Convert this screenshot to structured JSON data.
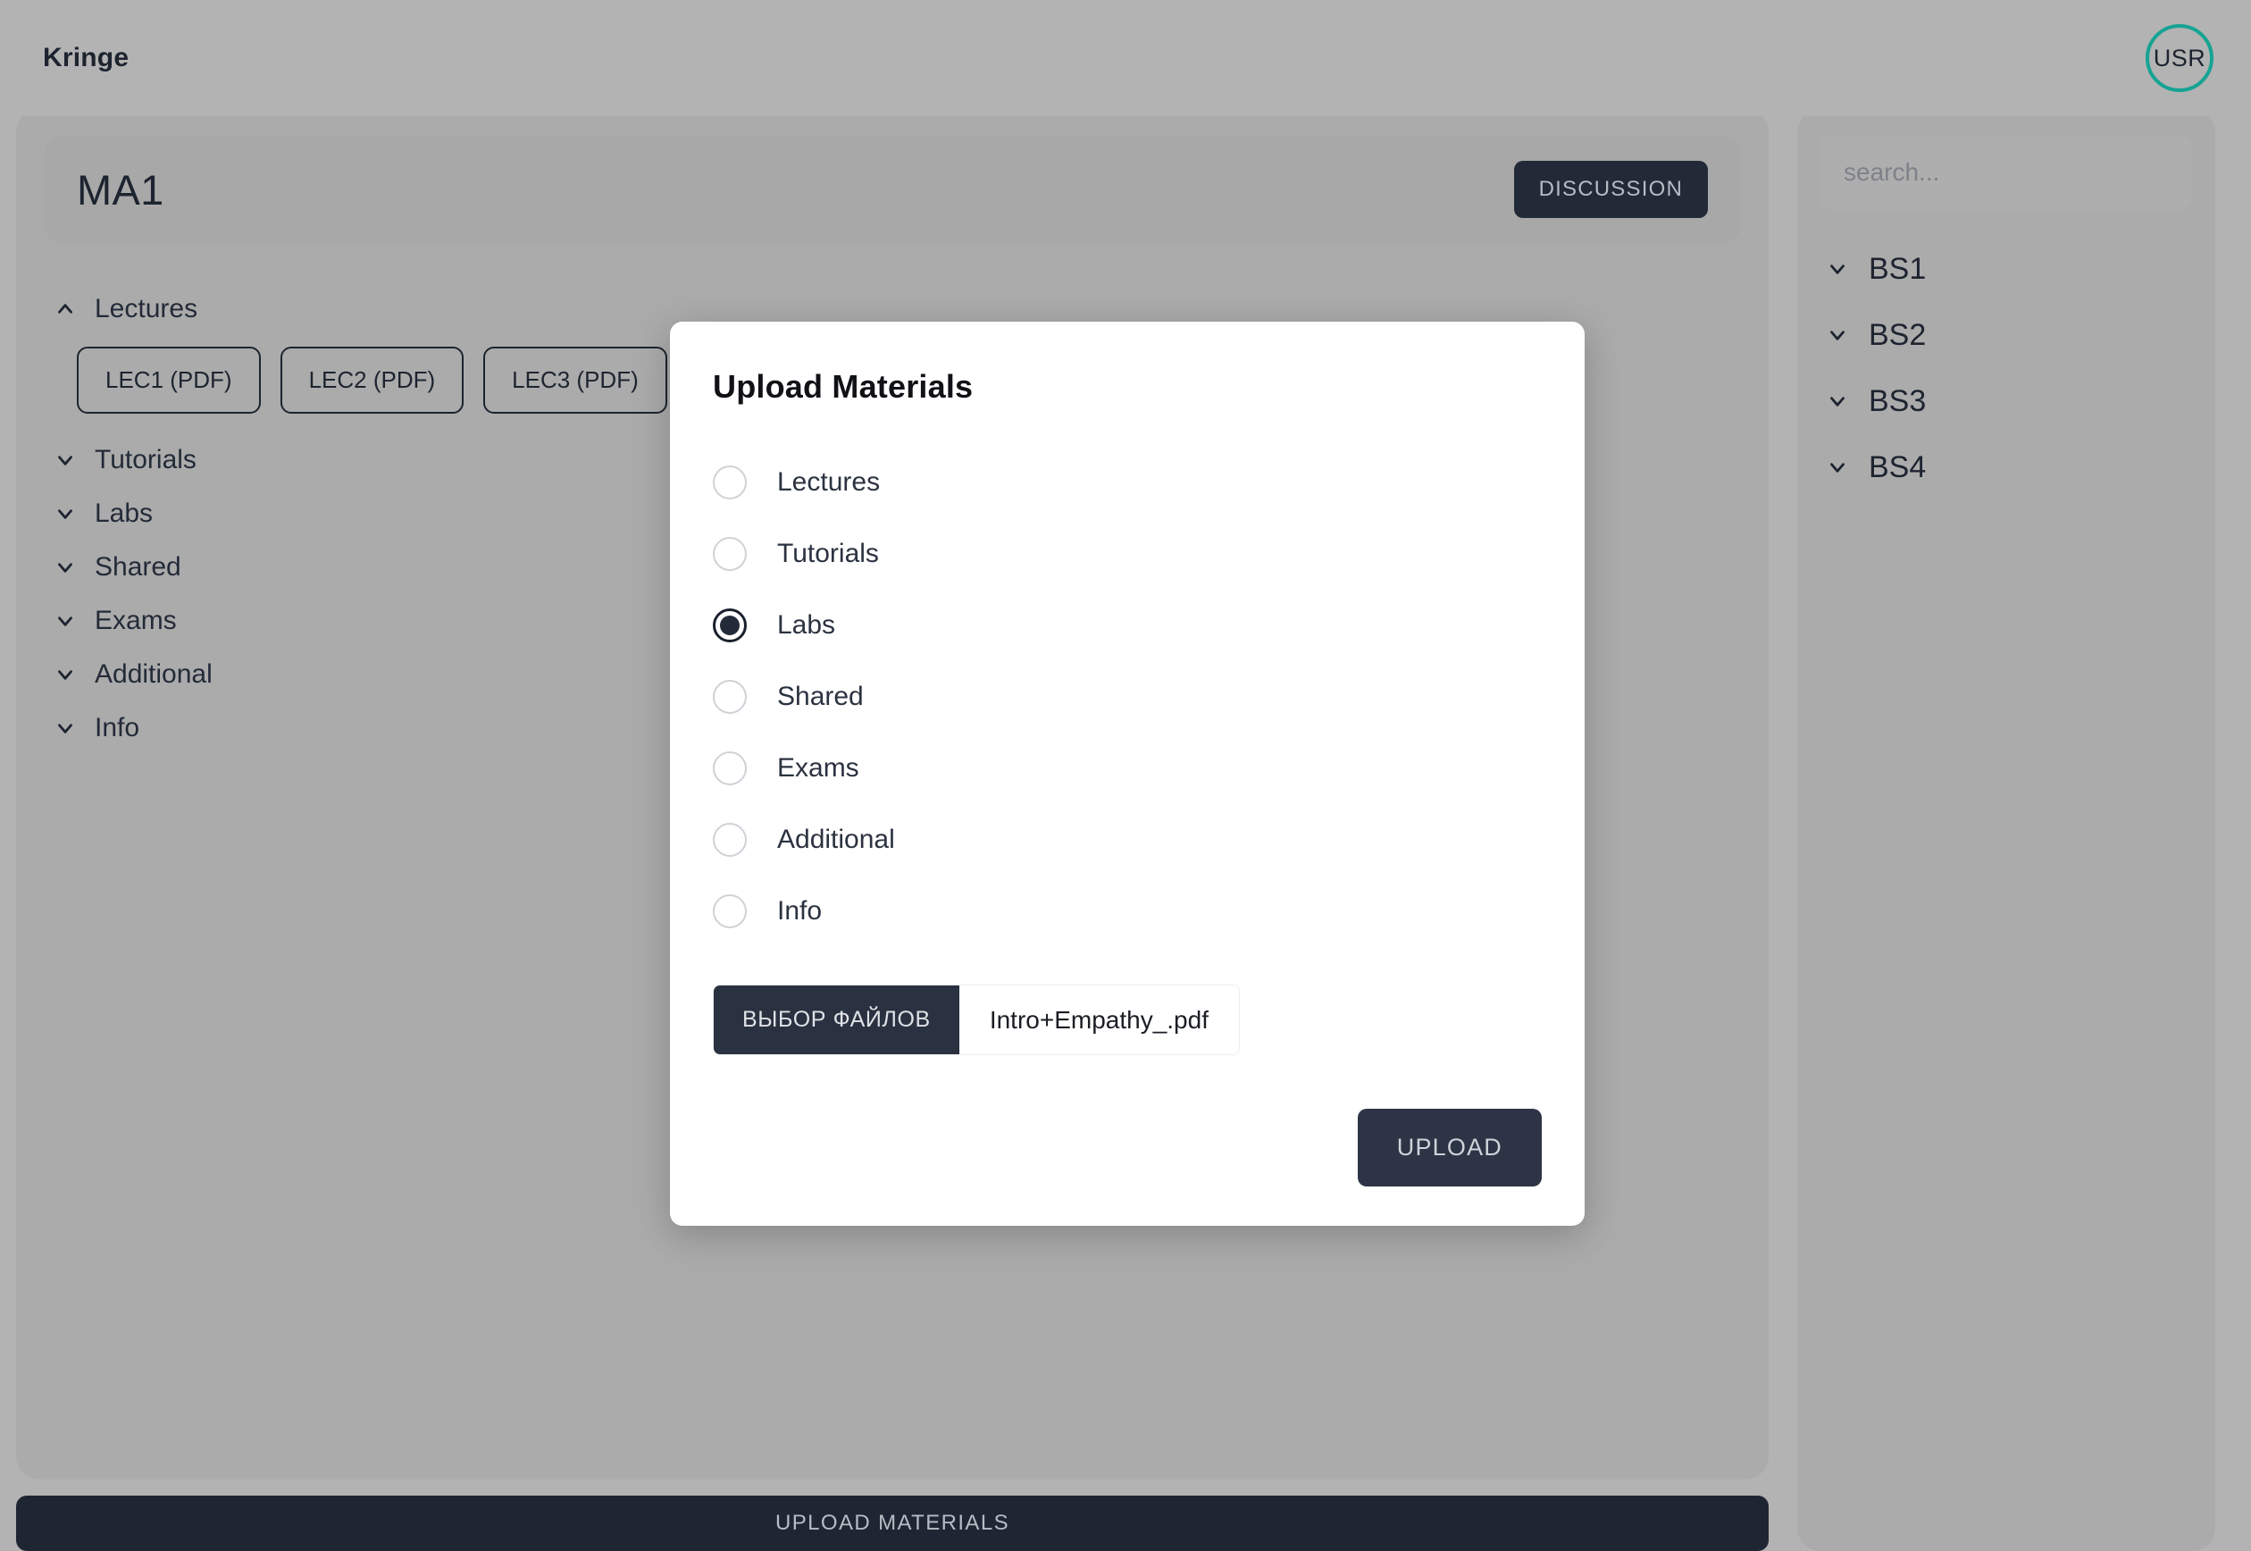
{
  "header": {
    "app_title": "Kringe",
    "avatar_initials": "USR",
    "avatar_ring_color": "#16a393"
  },
  "course": {
    "title": "MA1",
    "discussion_label": "DISCUSSION",
    "sections": [
      {
        "label": "Lectures",
        "expanded": true,
        "icon": "chevron-up-icon",
        "files": [
          "LEC1 (PDF)",
          "LEC2 (PDF)",
          "LEC3 (PDF)"
        ]
      },
      {
        "label": "Tutorials",
        "expanded": false,
        "icon": "chevron-down-icon",
        "files": []
      },
      {
        "label": "Labs",
        "expanded": false,
        "icon": "chevron-down-icon",
        "files": []
      },
      {
        "label": "Shared",
        "expanded": false,
        "icon": "chevron-down-icon",
        "files": []
      },
      {
        "label": "Exams",
        "expanded": false,
        "icon": "chevron-down-icon",
        "files": []
      },
      {
        "label": "Additional",
        "expanded": false,
        "icon": "chevron-down-icon",
        "files": []
      },
      {
        "label": "Info",
        "expanded": false,
        "icon": "chevron-down-icon",
        "files": []
      }
    ],
    "upload_materials_label": "UPLOAD MATERIALS"
  },
  "sidebar": {
    "search_placeholder": "search...",
    "search_value": "",
    "search_icon": "search-icon",
    "items": [
      {
        "label": "BS1",
        "icon": "chevron-down-icon"
      },
      {
        "label": "BS2",
        "icon": "chevron-down-icon"
      },
      {
        "label": "BS3",
        "icon": "chevron-down-icon"
      },
      {
        "label": "BS4",
        "icon": "chevron-down-icon"
      }
    ]
  },
  "modal": {
    "title": "Upload Materials",
    "options": [
      {
        "label": "Lectures",
        "selected": false
      },
      {
        "label": "Tutorials",
        "selected": false
      },
      {
        "label": "Labs",
        "selected": true
      },
      {
        "label": "Shared",
        "selected": false
      },
      {
        "label": "Exams",
        "selected": false
      },
      {
        "label": "Additional",
        "selected": false
      },
      {
        "label": "Info",
        "selected": false
      }
    ],
    "file_button_label": "ВЫБОР ФАЙЛОВ",
    "file_name": "Intro+Empathy_.pdf",
    "upload_label": "UPLOAD"
  },
  "colors": {
    "page_background": "#b3b3b3",
    "card_background": "#ababab",
    "dark_button": "#222a38",
    "accent_teal": "#16a393",
    "modal_background": "#ffffff"
  }
}
